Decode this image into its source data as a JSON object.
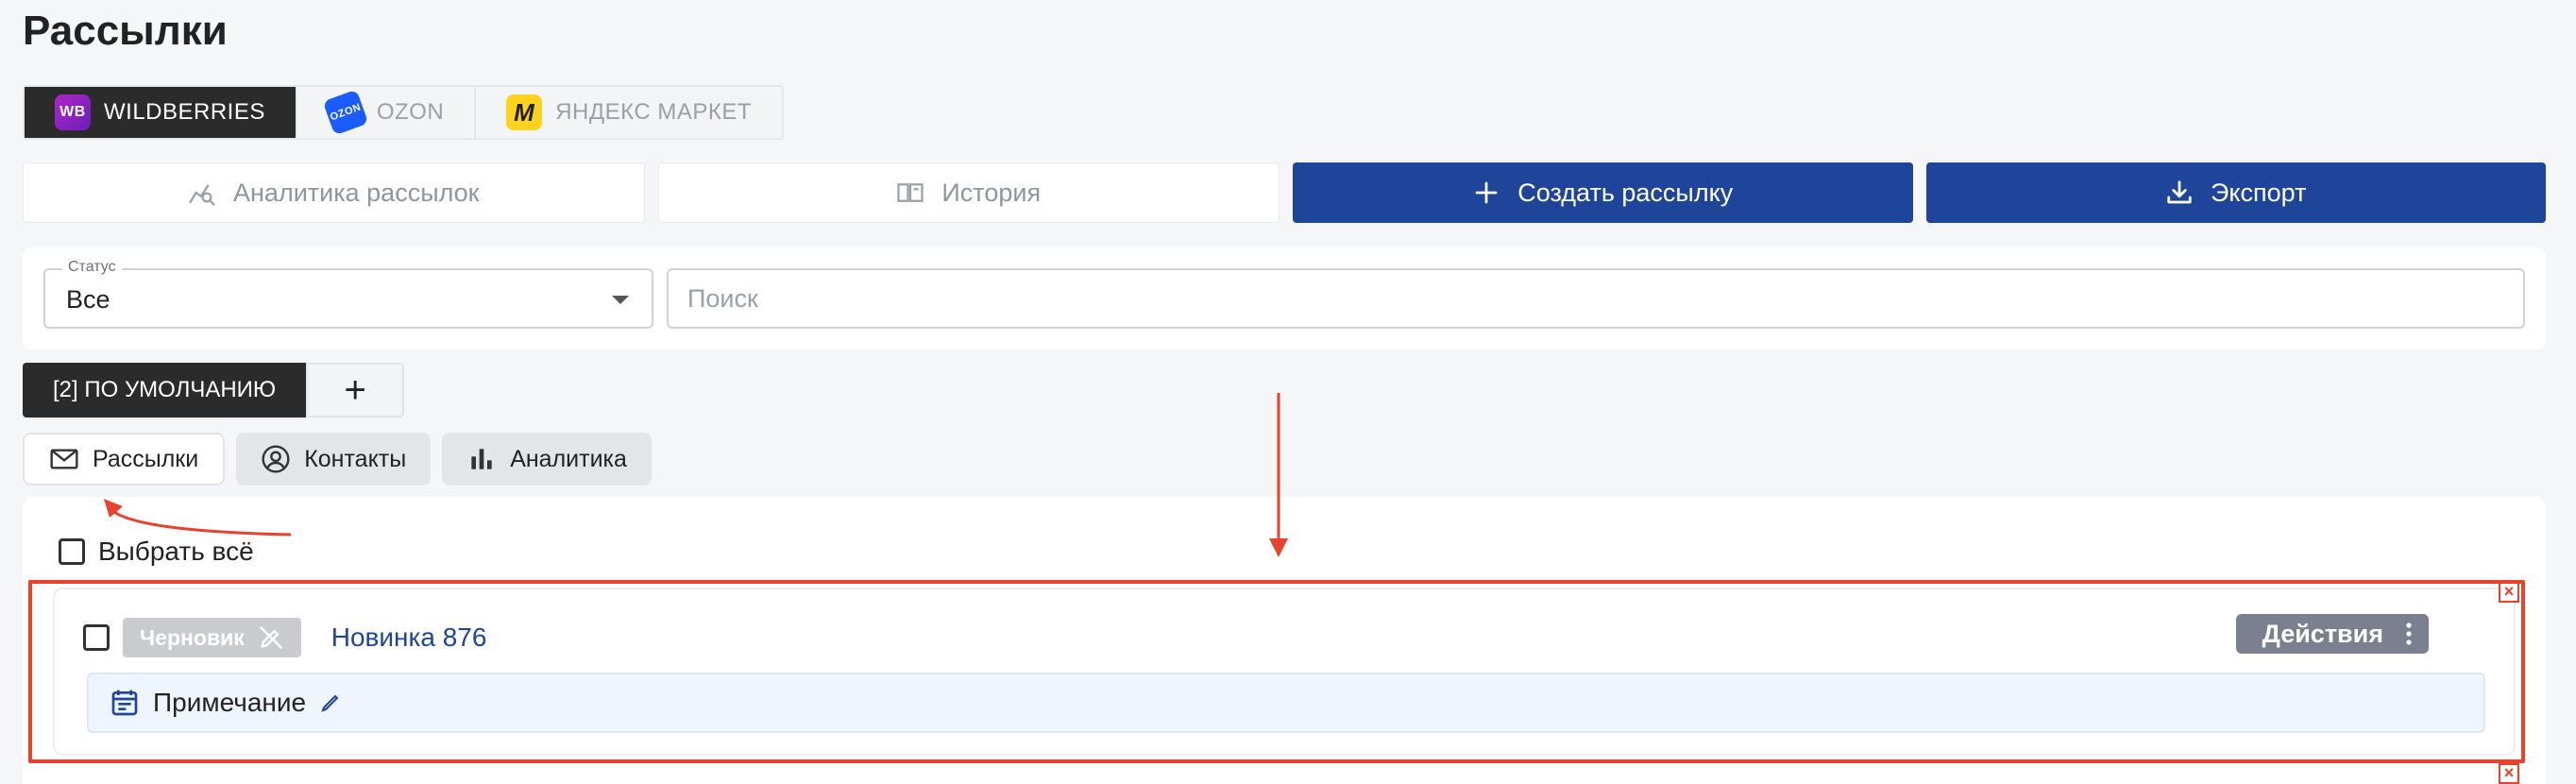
{
  "page": {
    "title": "Рассылки"
  },
  "marketplaces": [
    {
      "label": "WILDBERRIES",
      "logo": "WB",
      "active": true
    },
    {
      "label": "OZON",
      "logo": "OZON",
      "active": false
    },
    {
      "label": "ЯНДЕКС МАРКЕТ",
      "logo": "M",
      "active": false
    }
  ],
  "actions": {
    "analytics_label": "Аналитика рассылок",
    "history_label": "История",
    "create_label": "Создать рассылку",
    "export_label": "Экспорт"
  },
  "filters": {
    "status_legend": "Статус",
    "status_value": "Все",
    "search_placeholder": "Поиск"
  },
  "groups": {
    "active_label": "[2] ПО УМОЛЧАНИЮ",
    "add_label": "+"
  },
  "sections": [
    {
      "label": "Рассылки",
      "icon": "mail-icon",
      "active": true
    },
    {
      "label": "Контакты",
      "icon": "user-circle-icon",
      "active": false
    },
    {
      "label": "Аналитика",
      "icon": "bar-chart-icon",
      "active": false
    }
  ],
  "list": {
    "select_all_label": "Выбрать всё",
    "items": [
      {
        "status": "Черновик",
        "name": "Новинка 876",
        "actions_label": "Действия",
        "note_label": "Примечание"
      }
    ]
  },
  "colors": {
    "primary": "#1f459b",
    "annotation": "#e5432d",
    "actions_button": "#7b8090",
    "draft_badge": "#c9cbcf"
  }
}
